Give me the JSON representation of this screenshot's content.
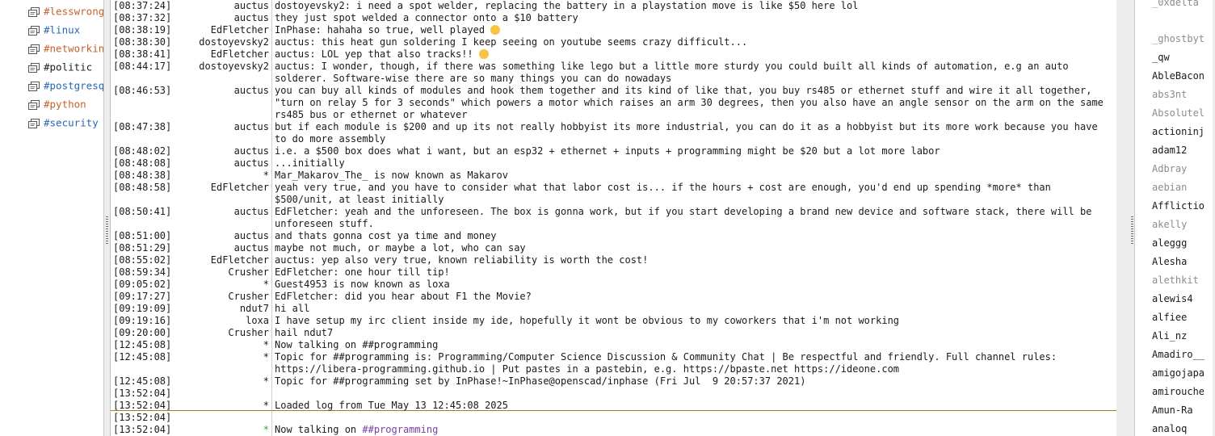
{
  "channels": [
    {
      "label": "#lesswrong",
      "color": "#c6622a"
    },
    {
      "label": "#linux",
      "color": "#2a67b3"
    },
    {
      "label": "#networking",
      "color": "#c6622a"
    },
    {
      "label": "#politic",
      "color": "#222222"
    },
    {
      "label": "#postgresql",
      "color": "#2a67b3"
    },
    {
      "label": "#python",
      "color": "#c6622a"
    },
    {
      "label": "#security",
      "color": "#2a67b3"
    }
  ],
  "messages": [
    {
      "ts": "[08:37:24]",
      "nick": "auctus",
      "text": "dostoyevsky2: i need a spot welder, replacing the battery in a playstation move is like $50 here lol"
    },
    {
      "ts": "[08:37:32]",
      "nick": "auctus",
      "text": "they just spot welded a connector onto a $10 battery"
    },
    {
      "ts": "[08:38:19]",
      "nick": "EdFletcher",
      "text": "InPhase: hahaha so true, well played ",
      "emoji": true
    },
    {
      "ts": "[08:38:30]",
      "nick": "dostoyevsky2",
      "text": "auctus: this heat gun soldering I keep seeing on youtube seems crazy difficult..."
    },
    {
      "ts": "[08:38:41]",
      "nick": "EdFletcher",
      "text": "auctus: LOL yep that also tracks!! ",
      "emoji": true
    },
    {
      "ts": "[08:44:17]",
      "nick": "dostoyevsky2",
      "text": "auctus: I wonder, though, if there was something like lego but a little more sturdy you could built all kinds of automation, e.g an auto solderer. Software-wise there are so many things you can do nowadays"
    },
    {
      "ts": "[08:46:53]",
      "nick": "auctus",
      "text": "you can buy all kinds of modules and hook them together and its kind of like that, you buy rs485 or ethernet stuff and wire it all together, \"turn on relay 5 for 3 seconds\" which powers a motor which raises an arm 30 degrees, then you also have an angle sensor on the arm on the same rs485 bus or ethernet or whatever"
    },
    {
      "ts": "[08:47:38]",
      "nick": "auctus",
      "text": "but if each module is $200 and up its not really hobbyist its more industrial, you can do it as a hobbyist but its more work because you have to do more assembly"
    },
    {
      "ts": "[08:48:02]",
      "nick": "auctus",
      "text": "i.e. a $500 box does what i want, but an esp32 + ethernet + inputs + programming might be $20 but a lot more labor"
    },
    {
      "ts": "[08:48:08]",
      "nick": "auctus",
      "text": "...initially"
    },
    {
      "ts": "[08:48:38]",
      "nick": "*",
      "text": "Mar_Makarov_The_ is now known as Makarov"
    },
    {
      "ts": "[08:48:58]",
      "nick": "EdFletcher",
      "text": "yeah very true, and you have to consider what that labor cost is... if the hours + cost are enough, you'd end up spending *more* than $500/unit, at least initially"
    },
    {
      "ts": "[08:50:41]",
      "nick": "auctus",
      "text": "EdFletcher: yeah and the unforeseen. The box is gonna work, but if you start developing a brand new device and software stack, there will be unforeseen stuff."
    },
    {
      "ts": "[08:51:00]",
      "nick": "auctus",
      "text": "and thats gonna cost ya time and money"
    },
    {
      "ts": "[08:51:29]",
      "nick": "auctus",
      "text": "maybe not much, or maybe a lot, who can say"
    },
    {
      "ts": "[08:55:02]",
      "nick": "EdFletcher",
      "text": "auctus: yep also very true, known reliability is worth the cost!"
    },
    {
      "ts": "[08:59:34]",
      "nick": "Crusher",
      "text": "EdFletcher: one hour till tip!"
    },
    {
      "ts": "[09:05:02]",
      "nick": "*",
      "text": "Guest4953 is now known as loxa"
    },
    {
      "ts": "[09:17:27]",
      "nick": "Crusher",
      "text": "EdFletcher: did you hear about F1 the Movie?"
    },
    {
      "ts": "[09:19:09]",
      "nick": "ndut7",
      "text": "hi all"
    },
    {
      "ts": "[09:19:16]",
      "nick": "loxa",
      "text": "I have setup my irc client inside my ide, hopefully it wont be obvious to my coworkers that i'm not working"
    },
    {
      "ts": "[09:20:00]",
      "nick": "Crusher",
      "text": "hail ndut7"
    },
    {
      "ts": "[12:45:08]",
      "nick": "*",
      "text": "Now talking on ##programming"
    },
    {
      "ts": "[12:45:08]",
      "nick": "*",
      "text": "Topic for ##programming is: Programming/Computer Science Discussion & Community Chat | Be respectful and friendly. Full channel rules: https://libera-programming.github.io | Put pastes in a pastebin, e.g. https://bpaste.net https://ideone.com"
    },
    {
      "ts": "[12:45:08]",
      "nick": "*",
      "text": "Topic for ##programming set by InPhase!~InPhase@openscad/inphase (Fri Jul  9 20:57:37 2021)"
    },
    {
      "ts": "[13:52:04]",
      "nick": "",
      "text": ""
    },
    {
      "ts": "[13:52:04]",
      "nick": "*",
      "text": "Loaded log from Tue May 13 12:45:08 2025"
    },
    {
      "ts": "[13:52:04]",
      "nick": "",
      "text": ""
    },
    {
      "ts": "[13:52:04]",
      "nick": "*",
      "text": "Now talking on ##programming",
      "nick_color": "#43a047",
      "highlight": "##programming"
    }
  ],
  "users": [
    {
      "name": "_0xdelta",
      "away": true
    },
    {
      "name": "_ghostbyt",
      "away": true
    },
    {
      "name": "_qw",
      "away": false
    },
    {
      "name": "AbleBacon",
      "away": false
    },
    {
      "name": "abs3nt",
      "away": true
    },
    {
      "name": "Absolutel",
      "away": true
    },
    {
      "name": "actioninj",
      "away": false
    },
    {
      "name": "adam12",
      "away": false
    },
    {
      "name": "Adbray",
      "away": true
    },
    {
      "name": "aebian",
      "away": true
    },
    {
      "name": "Afflictio",
      "away": false
    },
    {
      "name": "akelly",
      "away": true
    },
    {
      "name": "aleggg",
      "away": false
    },
    {
      "name": "Alesha",
      "away": false
    },
    {
      "name": "alethkit",
      "away": true
    },
    {
      "name": "alewis4",
      "away": false
    },
    {
      "name": "alfiee",
      "away": false
    },
    {
      "name": "Ali_nz",
      "away": false
    },
    {
      "name": "Amadiro__",
      "away": false
    },
    {
      "name": "amigojapa",
      "away": false
    },
    {
      "name": "amirouche",
      "away": false
    },
    {
      "name": "Amun-Ra",
      "away": false
    },
    {
      "name": "analoq",
      "away": false
    }
  ],
  "colors": {
    "highlight_channel": "#7b3fa0",
    "marker_line": "#a67c1f"
  }
}
